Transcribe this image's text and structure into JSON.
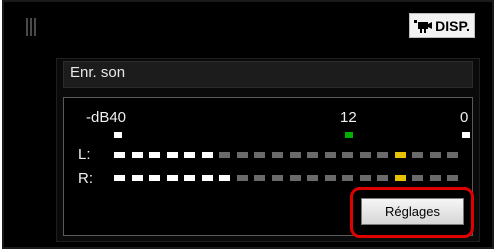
{
  "header": {
    "disp_label": "DISP.",
    "disp_icon": "movie-camera-icon"
  },
  "panel": {
    "title": "Enr. son"
  },
  "meter": {
    "scale_labels": [
      "-dB40",
      "12",
      "0"
    ],
    "channels": [
      {
        "label": "L:",
        "lit_segments": 6
      },
      {
        "label": "R:",
        "lit_segments": 7
      }
    ],
    "segment_count": 20,
    "peak_segment": 16,
    "colors": {
      "lit": "#ffffff",
      "unlit": "#6a6a6a",
      "peak": "#e6c200",
      "tick_green": "#00b000"
    }
  },
  "buttons": {
    "settings_label": "Réglages"
  }
}
